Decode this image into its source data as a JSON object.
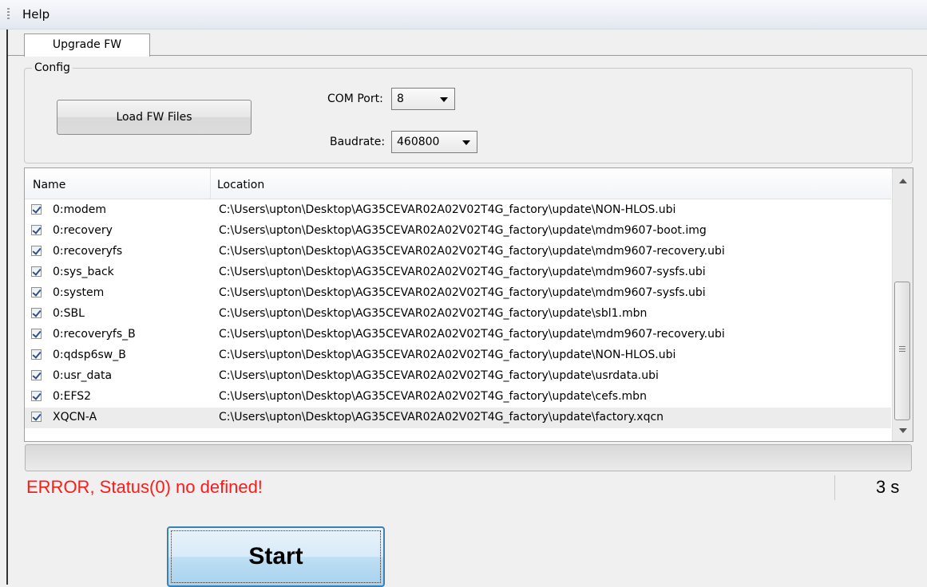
{
  "menubar": {
    "help_label": "Help"
  },
  "tabs": [
    {
      "label": "Upgrade FW",
      "active": true
    }
  ],
  "config": {
    "group_title": "Config",
    "load_button": "Load FW Files",
    "com_port_label": "COM Port:",
    "com_port_value": "8",
    "baudrate_label": "Baudrate:",
    "baudrate_value": "460800"
  },
  "table": {
    "columns": [
      "Name",
      "Location"
    ],
    "rows": [
      {
        "checked": true,
        "name": "0:modem",
        "location": "C:\\Users\\upton\\Desktop\\AG35CEVAR02A02V02T4G_factory\\update\\NON-HLOS.ubi"
      },
      {
        "checked": true,
        "name": "0:recovery",
        "location": "C:\\Users\\upton\\Desktop\\AG35CEVAR02A02V02T4G_factory\\update\\mdm9607-boot.img"
      },
      {
        "checked": true,
        "name": "0:recoveryfs",
        "location": "C:\\Users\\upton\\Desktop\\AG35CEVAR02A02V02T4G_factory\\update\\mdm9607-recovery.ubi"
      },
      {
        "checked": true,
        "name": "0:sys_back",
        "location": "C:\\Users\\upton\\Desktop\\AG35CEVAR02A02V02T4G_factory\\update\\mdm9607-sysfs.ubi"
      },
      {
        "checked": true,
        "name": "0:system",
        "location": "C:\\Users\\upton\\Desktop\\AG35CEVAR02A02V02T4G_factory\\update\\mdm9607-sysfs.ubi"
      },
      {
        "checked": true,
        "name": "0:SBL",
        "location": "C:\\Users\\upton\\Desktop\\AG35CEVAR02A02V02T4G_factory\\update\\sbl1.mbn"
      },
      {
        "checked": true,
        "name": "0:recoveryfs_B",
        "location": "C:\\Users\\upton\\Desktop\\AG35CEVAR02A02V02T4G_factory\\update\\mdm9607-recovery.ubi"
      },
      {
        "checked": true,
        "name": "0:qdsp6sw_B",
        "location": "C:\\Users\\upton\\Desktop\\AG35CEVAR02A02V02T4G_factory\\update\\NON-HLOS.ubi"
      },
      {
        "checked": true,
        "name": "0:usr_data",
        "location": "C:\\Users\\upton\\Desktop\\AG35CEVAR02A02V02T4G_factory\\update\\usrdata.ubi"
      },
      {
        "checked": true,
        "name": "0:EFS2",
        "location": "C:\\Users\\upton\\Desktop\\AG35CEVAR02A02V02T4G_factory\\update\\cefs.mbn"
      },
      {
        "checked": true,
        "name": "XQCN-A",
        "location": "C:\\Users\\upton\\Desktop\\AG35CEVAR02A02V02T4G_factory\\update\\factory.xqcn",
        "selected": true
      }
    ]
  },
  "progress": {
    "percent": 0
  },
  "status": {
    "message": "ERROR, Status(0) no defined!",
    "message_color": "#ff1a1a",
    "elapsed": "3 s"
  },
  "start_button": "Start"
}
